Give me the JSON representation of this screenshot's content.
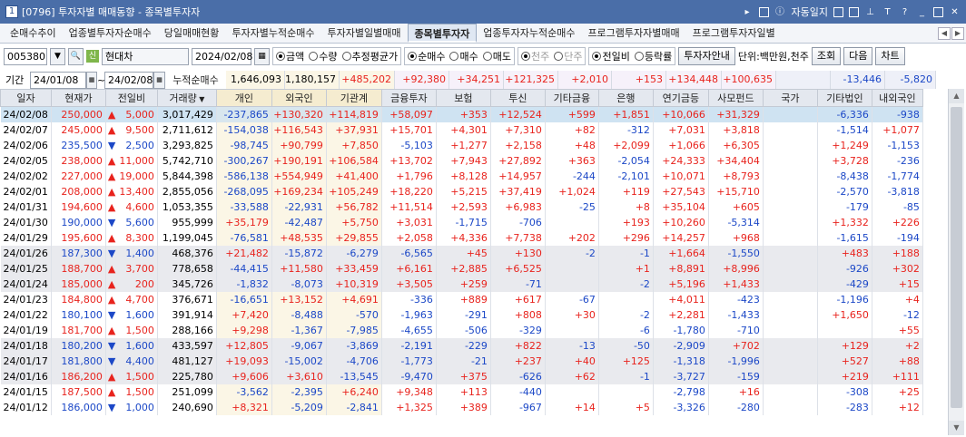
{
  "window": {
    "num": "1",
    "title": "[0796] 투자자별 매매동향 - 종목별투자자",
    "auto_label": "자동일지"
  },
  "tabs": [
    "순매수추이",
    "업종별투자자순매수",
    "당일매매현황",
    "투자자별누적순매수",
    "투자자별일별매매",
    "종목별투자자",
    "업종투자자누적순매수",
    "프로그램투자자별매매",
    "프로그램투자자일별"
  ],
  "active_tab": 5,
  "toolbar": {
    "code": "005380",
    "stock_badge": "신",
    "stock_name": "현대차",
    "date": "2024/02/08",
    "opt1": [
      "금액",
      "수량",
      "추정평균가"
    ],
    "opt2": [
      "순매수",
      "매수",
      "매도"
    ],
    "opt3": [
      "천주",
      "단주"
    ],
    "opt4": [
      "전일비",
      "등락률"
    ],
    "guide_btn": "투자자안내",
    "unit": "단위:백만원,천주",
    "query_btn": "조회",
    "next_btn": "다음",
    "chart_btn": "차트"
  },
  "period": {
    "label": "기간",
    "from": "24/01/08",
    "to": "24/02/08",
    "sep": "~",
    "sum_label": "누적순매수",
    "sums": [
      "1,646,093",
      "1,180,157",
      "+485,202",
      "+92,380",
      "+34,251",
      "+121,325",
      "+2,010",
      "+153",
      "+134,448",
      "+100,635",
      "",
      "-13,446",
      "-5,820"
    ]
  },
  "headers": [
    "일자",
    "현재가",
    "전일비",
    "거래량",
    "개인",
    "외국인",
    "기관계",
    "금융투자",
    "보험",
    "투신",
    "기타금융",
    "은행",
    "연기금등",
    "사모펀드",
    "국가",
    "기타법인",
    "내외국인"
  ],
  "rows": [
    [
      "24/02/08",
      "250,000",
      "u",
      "5,000",
      "3,017,429",
      "-237,865",
      "+130,320",
      "+114,819",
      "+58,097",
      "+353",
      "+12,524",
      "+599",
      "+1,851",
      "+10,066",
      "+31,329",
      "",
      "-6,336",
      "-938"
    ],
    [
      "24/02/07",
      "245,000",
      "u",
      "9,500",
      "2,711,612",
      "-154,038",
      "+116,543",
      "+37,931",
      "+15,701",
      "+4,301",
      "+7,310",
      "+82",
      "-312",
      "+7,031",
      "+3,818",
      "",
      "-1,514",
      "+1,077"
    ],
    [
      "24/02/06",
      "235,500",
      "d",
      "2,500",
      "3,293,825",
      "-98,745",
      "+90,799",
      "+7,850",
      "-5,103",
      "+1,277",
      "+2,158",
      "+48",
      "+2,099",
      "+1,066",
      "+6,305",
      "",
      "+1,249",
      "-1,153"
    ],
    [
      "24/02/05",
      "238,000",
      "u",
      "11,000",
      "5,742,710",
      "-300,267",
      "+190,191",
      "+106,584",
      "+13,702",
      "+7,943",
      "+27,892",
      "+363",
      "-2,054",
      "+24,333",
      "+34,404",
      "",
      "+3,728",
      "-236"
    ],
    [
      "24/02/02",
      "227,000",
      "u",
      "19,000",
      "5,844,398",
      "-586,138",
      "+554,949",
      "+41,400",
      "+1,796",
      "+8,128",
      "+14,957",
      "-244",
      "-2,101",
      "+10,071",
      "+8,793",
      "",
      "-8,438",
      "-1,774"
    ],
    [
      "24/02/01",
      "208,000",
      "u",
      "13,400",
      "2,855,056",
      "-268,095",
      "+169,234",
      "+105,249",
      "+18,220",
      "+5,215",
      "+37,419",
      "+1,024",
      "+119",
      "+27,543",
      "+15,710",
      "",
      "-2,570",
      "-3,818"
    ],
    [
      "24/01/31",
      "194,600",
      "u",
      "4,600",
      "1,053,355",
      "-33,588",
      "-22,931",
      "+56,782",
      "+11,514",
      "+2,593",
      "+6,983",
      "-25",
      "+8",
      "+35,104",
      "+605",
      "",
      "-179",
      "-85"
    ],
    [
      "24/01/30",
      "190,000",
      "d",
      "5,600",
      "955,999",
      "+35,179",
      "-42,487",
      "+5,750",
      "+3,031",
      "-1,715",
      "-706",
      "",
      "+193",
      "+10,260",
      "-5,314",
      "",
      "+1,332",
      "+226"
    ],
    [
      "24/01/29",
      "195,600",
      "u",
      "8,300",
      "1,199,045",
      "-76,581",
      "+48,535",
      "+29,855",
      "+2,058",
      "+4,336",
      "+7,738",
      "+202",
      "+296",
      "+14,257",
      "+968",
      "",
      "-1,615",
      "-194"
    ],
    [
      "24/01/26",
      "187,300",
      "d",
      "1,400",
      "468,376",
      "+21,482",
      "-15,872",
      "-6,279",
      "-6,565",
      "+45",
      "+130",
      "-2",
      "-1",
      "+1,664",
      "-1,550",
      "",
      "+483",
      "+188"
    ],
    [
      "24/01/25",
      "188,700",
      "u",
      "3,700",
      "778,658",
      "-44,415",
      "+11,580",
      "+33,459",
      "+6,161",
      "+2,885",
      "+6,525",
      "",
      "+1",
      "+8,891",
      "+8,996",
      "",
      "-926",
      "+302"
    ],
    [
      "24/01/24",
      "185,000",
      "u",
      "200",
      "345,726",
      "-1,832",
      "-8,073",
      "+10,319",
      "+3,505",
      "+259",
      "-71",
      "",
      "-2",
      "+5,196",
      "+1,433",
      "",
      "-429",
      "+15"
    ],
    [
      "24/01/23",
      "184,800",
      "u",
      "4,700",
      "376,671",
      "-16,651",
      "+13,152",
      "+4,691",
      "-336",
      "+889",
      "+617",
      "-67",
      "",
      "+4,011",
      "-423",
      "",
      "-1,196",
      "+4"
    ],
    [
      "24/01/22",
      "180,100",
      "d",
      "1,600",
      "391,914",
      "+7,420",
      "-8,488",
      "-570",
      "-1,963",
      "-291",
      "+808",
      "+30",
      "-2",
      "+2,281",
      "-1,433",
      "",
      "+1,650",
      "-12"
    ],
    [
      "24/01/19",
      "181,700",
      "u",
      "1,500",
      "288,166",
      "+9,298",
      "-1,367",
      "-7,985",
      "-4,655",
      "-506",
      "-329",
      "",
      "-6",
      "-1,780",
      "-710",
      "",
      "",
      "+55"
    ],
    [
      "24/01/18",
      "180,200",
      "d",
      "1,600",
      "433,597",
      "+12,805",
      "-9,067",
      "-3,869",
      "-2,191",
      "-229",
      "+822",
      "-13",
      "-50",
      "-2,909",
      "+702",
      "",
      "+129",
      "+2"
    ],
    [
      "24/01/17",
      "181,800",
      "d",
      "4,400",
      "481,127",
      "+19,093",
      "-15,002",
      "-4,706",
      "-1,773",
      "-21",
      "+237",
      "+40",
      "+125",
      "-1,318",
      "-1,996",
      "",
      "+527",
      "+88"
    ],
    [
      "24/01/16",
      "186,200",
      "u",
      "1,500",
      "225,780",
      "+9,606",
      "+3,610",
      "-13,545",
      "-9,470",
      "+375",
      "-626",
      "+62",
      "-1",
      "-3,727",
      "-159",
      "",
      "+219",
      "+111"
    ],
    [
      "24/01/15",
      "187,500",
      "u",
      "1,500",
      "251,099",
      "-3,562",
      "-2,395",
      "+6,240",
      "+9,348",
      "+113",
      "-440",
      "",
      "",
      "-2,798",
      "+16",
      "",
      "-308",
      "+25"
    ],
    [
      "24/01/12",
      "186,000",
      "d",
      "1,000",
      "240,690",
      "+8,321",
      "-5,209",
      "-2,841",
      "+1,325",
      "+389",
      "-967",
      "+14",
      "+5",
      "-3,326",
      "-280",
      "",
      "-283",
      "+12"
    ]
  ],
  "colors": {
    "up": "#e8231d",
    "down": "#1c48c7",
    "selected_row": "#cfe3f2",
    "titlebar": "#4a6ea8"
  }
}
